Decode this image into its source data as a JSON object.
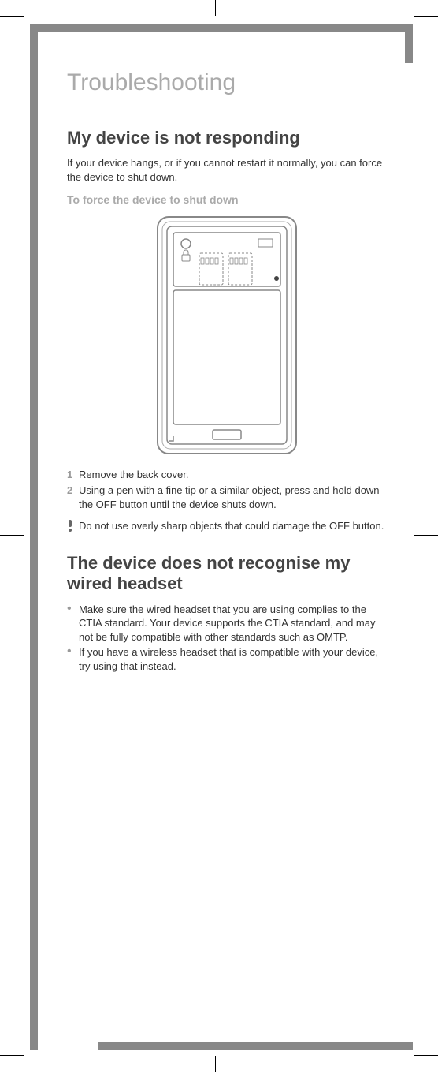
{
  "title": "Troubleshooting",
  "section1": {
    "heading": "My device is not responding",
    "intro": "If your device hangs, or if you cannot restart it normally, you can force the device to shut down.",
    "sub": "To force the device to shut down",
    "steps": [
      "Remove the back cover.",
      "Using a pen with a fine tip or a similar object, press and hold down the OFF button until the device shuts down."
    ],
    "warning": "Do not use overly sharp objects that could damage the OFF button."
  },
  "section2": {
    "heading": "The device does not recognise my wired headset",
    "bullets": [
      "Make sure the wired headset that you are using complies to the CTIA standard. Your device supports the CTIA standard, and may not be fully compatible with other standards such as OMTP.",
      "If you have a wireless headset that is compatible with your device, try using that instead."
    ]
  }
}
